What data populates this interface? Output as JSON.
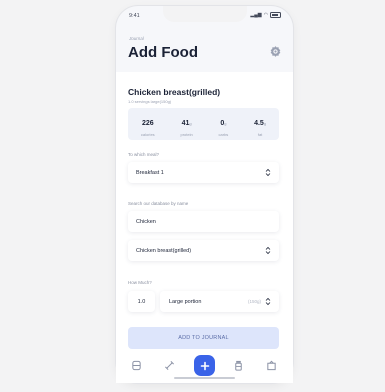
{
  "status": {
    "time": "9:41"
  },
  "header": {
    "overline": "Journal",
    "title": "Add Food"
  },
  "food": {
    "name": "Chicken breast(grilled)",
    "serving": "1.0 servings large(150g)",
    "macros": [
      {
        "value": "226",
        "unit": "",
        "label": "calories"
      },
      {
        "value": "41",
        "unit": "g",
        "label": "protein"
      },
      {
        "value": "0",
        "unit": "g",
        "label": "carbs"
      },
      {
        "value": "4.5",
        "unit": "g",
        "label": "fat"
      }
    ]
  },
  "meal": {
    "label": "To which meal?",
    "value": "Breakfast 1"
  },
  "search": {
    "label": "Search our database by name",
    "query": "Chicken",
    "result": "Chicken breast(grilled)"
  },
  "quantity": {
    "label": "How Much?",
    "amount": "1.0",
    "portion": "Large portion",
    "grams": "(150g)"
  },
  "actions": {
    "add_label": "ADD TO JOURNAL"
  },
  "colors": {
    "accent": "#3a63e8",
    "button_bg": "#dde5fb"
  }
}
